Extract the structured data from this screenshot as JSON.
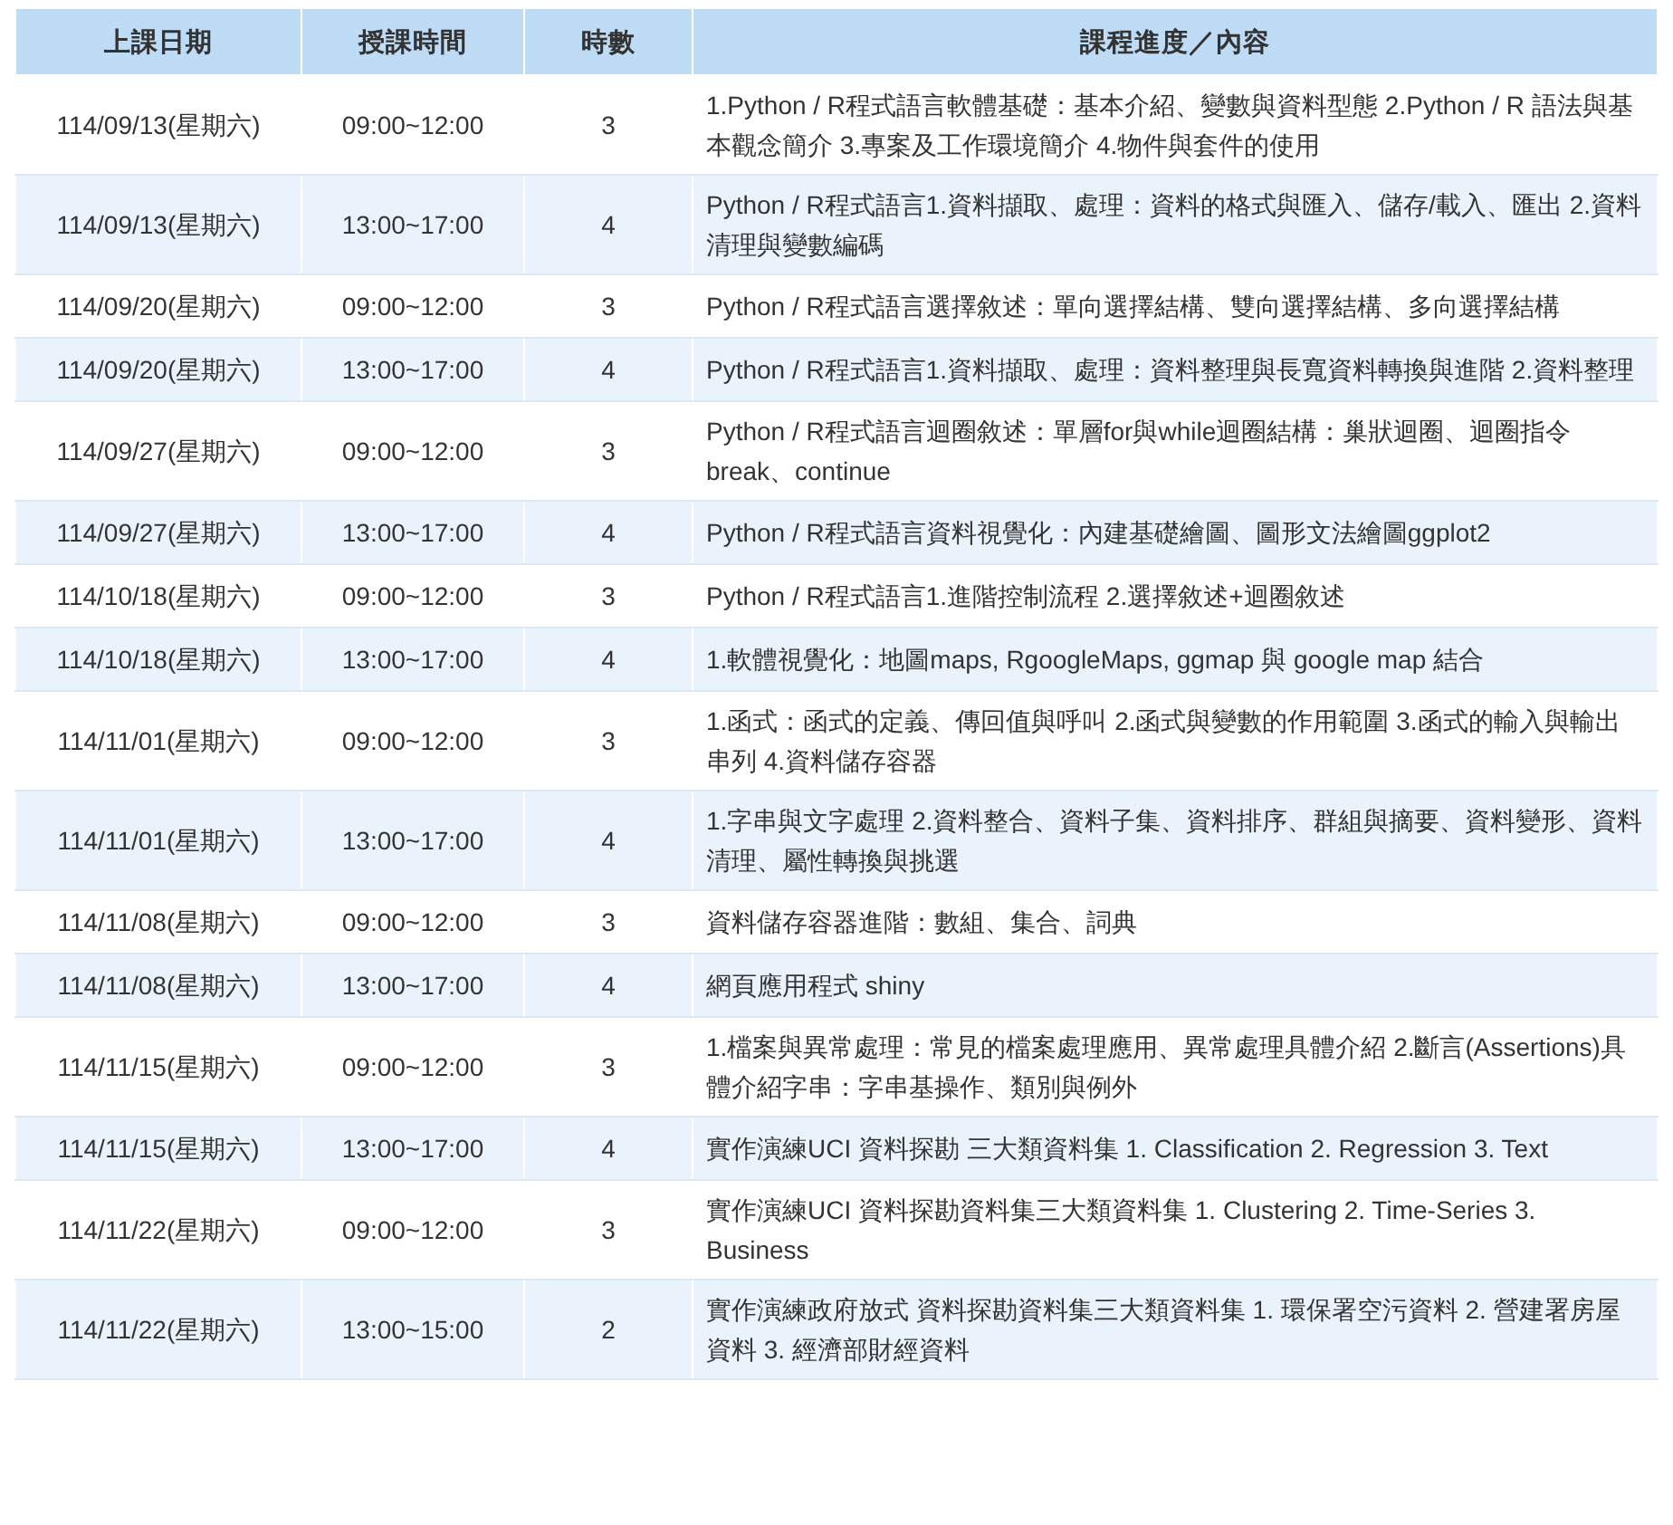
{
  "table": {
    "columns": [
      "上課日期",
      "授課時間",
      "時數",
      "課程進度／內容"
    ],
    "rows": [
      [
        "114/09/13(星期六)",
        "09:00~12:00",
        "3",
        "1.Python / R程式語言軟體基礎：基本介紹、變數與資料型態 2.Python / R 語法與基本觀念簡介 3.專案及工作環境簡介 4.物件與套件的使用"
      ],
      [
        "114/09/13(星期六)",
        "13:00~17:00",
        "4",
        "Python / R程式語言1.資料擷取、處理：資料的格式與匯入、儲存/載入、匯出 2.資料清理與變數編碼"
      ],
      [
        "114/09/20(星期六)",
        "09:00~12:00",
        "3",
        "Python / R程式語言選擇敘述：單向選擇結構、雙向選擇結構、多向選擇結構"
      ],
      [
        "114/09/20(星期六)",
        "13:00~17:00",
        "4",
        "Python / R程式語言1.資料擷取、處理：資料整理與長寬資料轉換與進階 2.資料整理"
      ],
      [
        "114/09/27(星期六)",
        "09:00~12:00",
        "3",
        "Python / R程式語言迴圈敘述：單層for與while迴圈結構：巢狀迴圈、迴圈指令break、continue"
      ],
      [
        "114/09/27(星期六)",
        "13:00~17:00",
        "4",
        "Python / R程式語言資料視覺化：內建基礎繪圖、圖形文法繪圖ggplot2"
      ],
      [
        "114/10/18(星期六)",
        "09:00~12:00",
        "3",
        "Python / R程式語言1.進階控制流程 2.選擇敘述+迴圈敘述"
      ],
      [
        "114/10/18(星期六)",
        "13:00~17:00",
        "4",
        "1.軟體視覺化：地圖maps, RgoogleMaps, ggmap 與 google map 結合"
      ],
      [
        "114/11/01(星期六)",
        "09:00~12:00",
        "3",
        "1.函式：函式的定義、傳回值與呼叫 2.函式與變數的作用範圍 3.函式的輸入與輸出串列 4.資料儲存容器"
      ],
      [
        "114/11/01(星期六)",
        "13:00~17:00",
        "4",
        "1.字串與文字處理 2.資料整合、資料子集、資料排序、群組與摘要、資料變形、資料清理、屬性轉換與挑選"
      ],
      [
        "114/11/08(星期六)",
        "09:00~12:00",
        "3",
        "資料儲存容器進階：數組、集合、詞典"
      ],
      [
        "114/11/08(星期六)",
        "13:00~17:00",
        "4",
        "網頁應用程式 shiny"
      ],
      [
        "114/11/15(星期六)",
        "09:00~12:00",
        "3",
        "1.檔案與異常處理：常見的檔案處理應用、異常處理具體介紹 2.斷言(Assertions)具體介紹字串：字串基操作、類別與例外"
      ],
      [
        "114/11/15(星期六)",
        "13:00~17:00",
        "4",
        "實作演練UCI 資料探勘 三大類資料集 1. Classification 2. Regression 3. Text"
      ],
      [
        "114/11/22(星期六)",
        "09:00~12:00",
        "3",
        "實作演練UCI 資料探勘資料集三大類資料集 1. Clustering 2. Time-Series 3. Business"
      ],
      [
        "114/11/22(星期六)",
        "13:00~15:00",
        "2",
        "實作演練政府放式 資料探勘資料集三大類資料集 1. 環保署空污資料 2. 營建署房屋資料 3. 經濟部財經資料"
      ]
    ]
  }
}
